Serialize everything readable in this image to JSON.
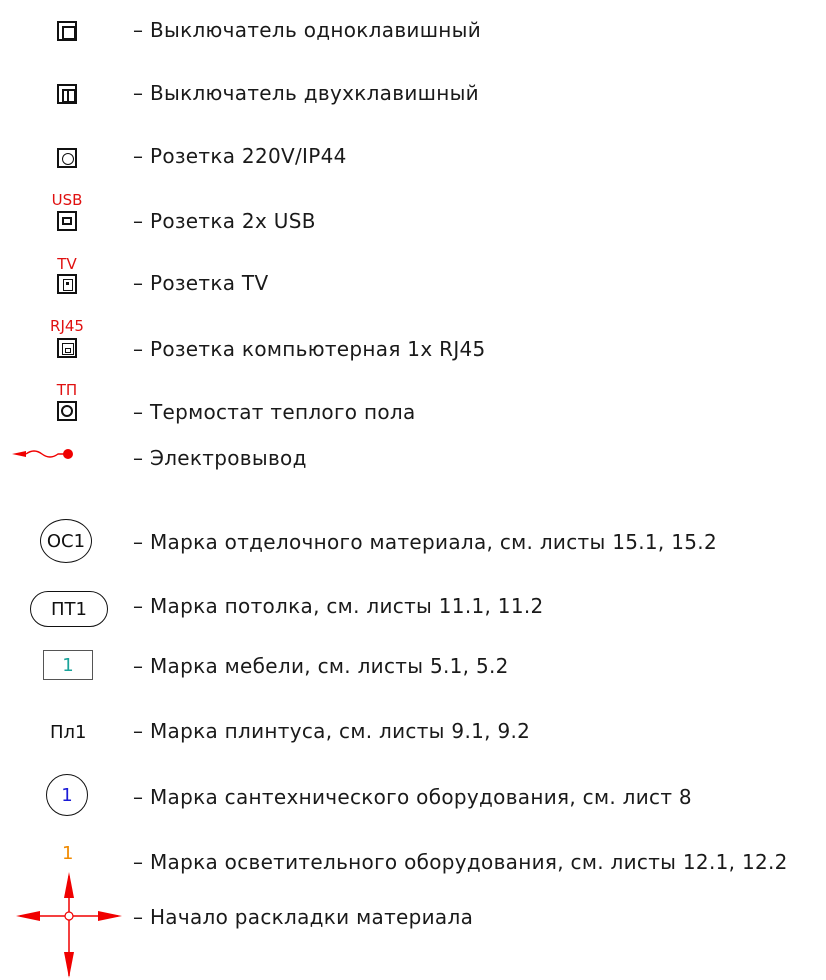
{
  "legend": {
    "rows": [
      {
        "text": "– Выключатель одноклавишный"
      },
      {
        "text": "– Выключатель двухклавишный"
      },
      {
        "text": "– Розетка  220V/IP44"
      },
      {
        "text": "– Розетка 2х USB"
      },
      {
        "text": "– Розетка TV"
      },
      {
        "text": "– Розетка компьютерная 1х RJ45"
      },
      {
        "text": "– Термостат теплого пола"
      },
      {
        "text": "– Электровывод"
      },
      {
        "text": "– Марка отделочного материала, см. листы 15.1, 15.2"
      },
      {
        "text": "– Марка потолка, см. листы 11.1, 11.2"
      },
      {
        "text": "– Марка мебели, см. листы 5.1, 5.2"
      },
      {
        "text": "– Марка плинтуса, см. листы 9.1, 9.2"
      },
      {
        "text": "– Марка сантехнического оборудования, см. лист 8"
      },
      {
        "text": "– Марка осветительного оборудования, см. листы 12.1, 12.2"
      },
      {
        "text": "– Начало раскладки материала"
      }
    ],
    "symbol_labels": {
      "usb": "USB",
      "tv": "TV",
      "rj45": "RJ45",
      "tp": "ТП",
      "finish_mark": "ОС1",
      "ceiling_mark": "ПТ1",
      "furniture_mark": "1",
      "baseboard_mark": "Пл1",
      "plumbing_mark": "1",
      "lighting_mark": "1"
    },
    "colors": {
      "red_label": "#e01010",
      "furniture_mark": "#1aa39a",
      "plumbing_mark": "#1b1bd6",
      "lighting_mark": "#f08a00",
      "arrow": "#f00000"
    }
  }
}
